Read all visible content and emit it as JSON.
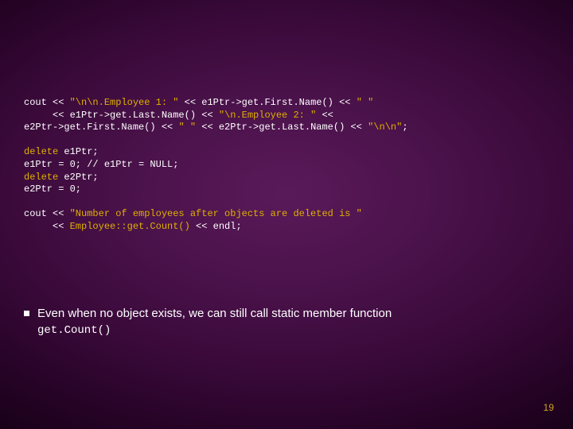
{
  "code": {
    "l1a": "cout << ",
    "l1b": "\"\\n\\n.Employee 1: \"",
    "l1c": " << e1Ptr->get.First.Name() << ",
    "l1d": "\" \"",
    "l2a": "     << e1Ptr->get.Last.Name() << ",
    "l2b": "\"\\n.Employee 2: \"",
    "l2c": " << ",
    "l3a": "e2Ptr->get.First.Name() << ",
    "l3b": "\" \"",
    "l3c": " << e2Ptr->get.Last.Name() << ",
    "l3d": "\"\\n\\n\"",
    "l3e": ";",
    "blank1": "",
    "l5": "delete",
    "l5b": " e1Ptr;",
    "l6": "e1Ptr = 0; // e1Ptr = NULL;",
    "l7": "delete",
    "l7b": " e2Ptr;",
    "l8": "e2Ptr = 0;",
    "blank2": "",
    "l10a": "cout << ",
    "l10b": "\"Number of employees after objects are deleted is \"",
    "l11a": "     << ",
    "l11b": "Employee::get.Count()",
    "l11c": " << endl;"
  },
  "bullet": {
    "text": "Even when no object exists, we can still call static member function",
    "code": "get.Count()"
  },
  "page_number": "19"
}
